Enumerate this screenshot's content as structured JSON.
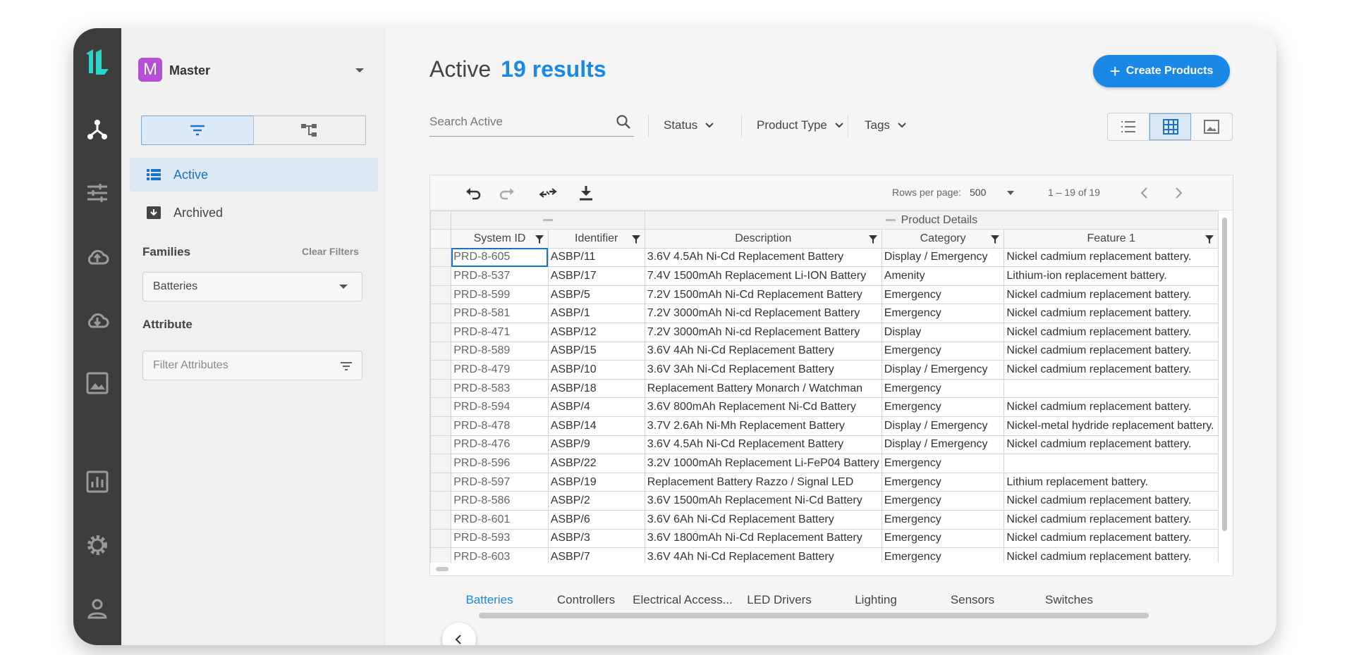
{
  "workspace": {
    "badge": "M",
    "name": "Master"
  },
  "panel": {
    "nav": [
      {
        "label": "Active"
      },
      {
        "label": "Archived"
      }
    ],
    "families_title": "Families",
    "clear_filters": "Clear Filters",
    "family_selected": "Batteries",
    "attribute_title": "Attribute",
    "attribute_placeholder": "Filter Attributes"
  },
  "header": {
    "title": "Active",
    "count": "19 results",
    "create_button": "Create Products"
  },
  "filters": {
    "search_placeholder": "Search Active",
    "status": "Status",
    "product_type": "Product Type",
    "tags": "Tags"
  },
  "toolbar": {
    "rows_per_page_label": "Rows per page:",
    "rows_per_page_value": "500",
    "range": "1 – 19 of 19"
  },
  "grid": {
    "group_header": "Product Details",
    "columns": [
      "System ID",
      "Identifier",
      "Description",
      "Category",
      "Feature 1"
    ],
    "rows": [
      [
        "PRD-8-605",
        "ASBP/11",
        "3.6V 4.5Ah Ni-Cd Replacement Battery",
        "Display / Emergency",
        "Nickel cadmium replacement battery."
      ],
      [
        "PRD-8-537",
        "ASBP/17",
        "7.4V 1500mAh Replacement Li-ION Battery",
        "Amenity",
        "Lithium-ion replacement battery."
      ],
      [
        "PRD-8-599",
        "ASBP/5",
        "7.2V 1500mAh Ni-Cd Replacement Battery",
        "Emergency",
        "Nickel cadmium replacement battery."
      ],
      [
        "PRD-8-581",
        "ASBP/1",
        "7.2V 3000mAh Ni-cd Replacement Battery",
        "Emergency",
        "Nickel cadmium replacement battery."
      ],
      [
        "PRD-8-471",
        "ASBP/12",
        "7.2V 3000mAh Ni-cd Replacement Battery",
        "Display",
        "Nickel cadmium replacement battery."
      ],
      [
        "PRD-8-589",
        "ASBP/15",
        "3.6V 4Ah Ni-Cd Replacement Battery",
        "Emergency",
        "Nickel cadmium replacement battery."
      ],
      [
        "PRD-8-479",
        "ASBP/10",
        "3.6V 3Ah Ni-Cd Replacement Battery",
        "Display / Emergency",
        "Nickel cadmium replacement battery."
      ],
      [
        "PRD-8-583",
        "ASBP/18",
        "Replacement Battery Monarch / Watchman",
        "Emergency",
        ""
      ],
      [
        "PRD-8-594",
        "ASBP/4",
        "3.6V 800mAh Replacement Ni-Cd Battery",
        "Emergency",
        "Nickel cadmium replacement battery."
      ],
      [
        "PRD-8-478",
        "ASBP/14",
        "3.7V 2.6Ah Ni-Mh Replacement Battery",
        "Display / Emergency",
        "Nickel-metal hydride replacement battery."
      ],
      [
        "PRD-8-476",
        "ASBP/9",
        "3.6V 4.5Ah Ni-Cd Replacement Battery",
        "Display / Emergency",
        "Nickel cadmium replacement battery."
      ],
      [
        "PRD-8-596",
        "ASBP/22",
        "3.2V 1000mAh Replacement Li-FeP04 Battery",
        "Emergency",
        ""
      ],
      [
        "PRD-8-597",
        "ASBP/19",
        "Replacement Battery Razzo / Signal LED",
        "Emergency",
        "Lithium replacement battery."
      ],
      [
        "PRD-8-586",
        "ASBP/2",
        "3.6V 1500mAh Replacement Ni-Cd Battery",
        "Emergency",
        "Nickel cadmium replacement battery."
      ],
      [
        "PRD-8-601",
        "ASBP/6",
        "3.6V 6Ah Ni-Cd Replacement Battery",
        "Emergency",
        "Nickel cadmium replacement battery."
      ],
      [
        "PRD-8-593",
        "ASBP/3",
        "3.6V 1800mAh Ni-Cd Replacement Battery",
        "Emergency",
        "Nickel cadmium replacement battery."
      ],
      [
        "PRD-8-603",
        "ASBP/7",
        "3.6V 4Ah Ni-Cd Replacement Battery",
        "Emergency",
        "Nickel cadmium replacement battery."
      ]
    ]
  },
  "family_tabs": [
    {
      "label": "Batteries",
      "active": true
    },
    {
      "label": "Controllers"
    },
    {
      "label": "Electrical Access..."
    },
    {
      "label": "LED Drivers"
    },
    {
      "label": "Lighting"
    },
    {
      "label": "Sensors"
    },
    {
      "label": "Switches"
    }
  ],
  "colors": {
    "accent": "#1a88e6",
    "rail": "#3d3d3d",
    "logo": "#2ad4c8",
    "badge": "#b44fd6"
  },
  "icons": [
    "logo-icon",
    "hierarchy-icon",
    "sliders-icon",
    "cloud-upload-icon",
    "cloud-download-icon",
    "image-icon",
    "chart-icon",
    "gear-icon",
    "user-icon"
  ]
}
